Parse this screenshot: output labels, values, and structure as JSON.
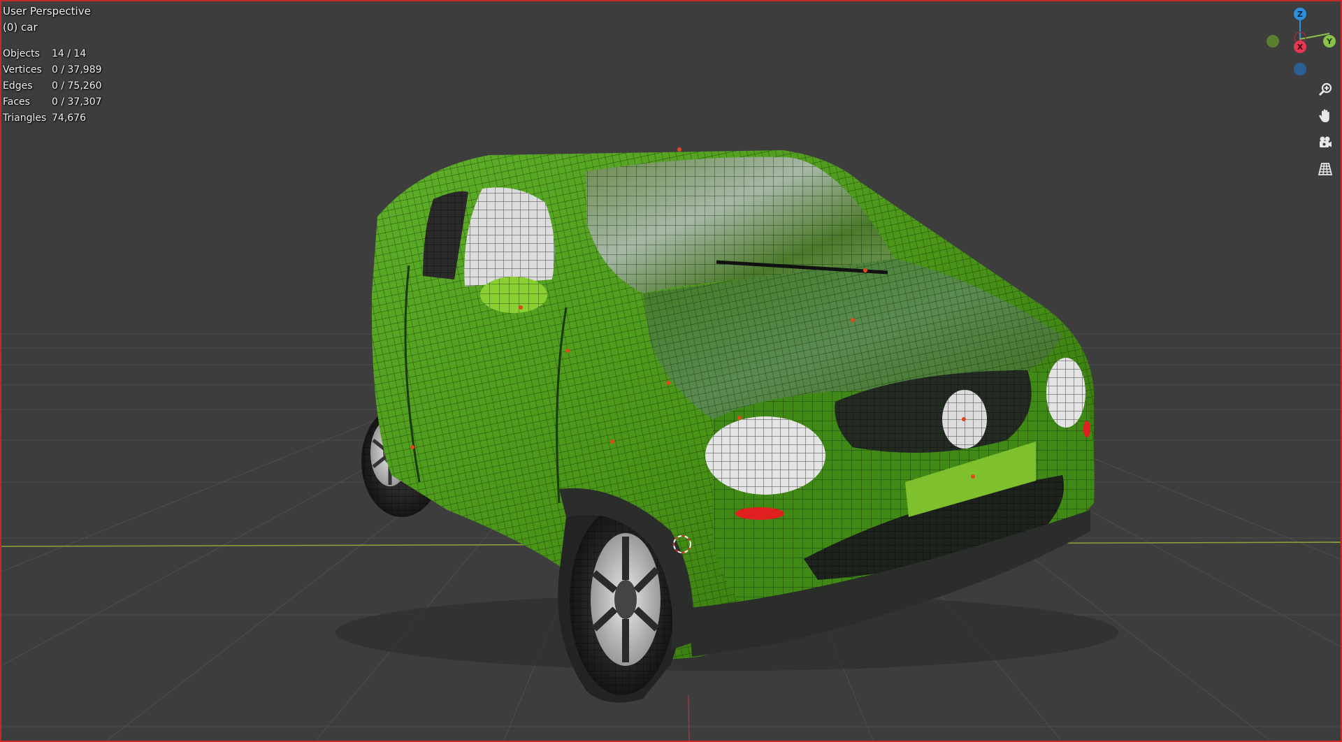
{
  "viewport": {
    "view_name": "User Perspective",
    "object_name": "(0) car"
  },
  "stats": [
    {
      "label": "Objects",
      "value": "14 / 14"
    },
    {
      "label": "Vertices",
      "value": "0 / 37,989"
    },
    {
      "label": "Edges",
      "value": "0 / 75,260"
    },
    {
      "label": "Faces",
      "value": "0 / 37,307"
    },
    {
      "label": "Triangles",
      "value": "74,676"
    }
  ],
  "gizmo": {
    "axes": {
      "x": "X",
      "y": "Y",
      "z": "Z"
    },
    "colors": {
      "x": "#e8384f",
      "y": "#8bc34a",
      "z": "#2d8fe0",
      "neg_x": "#9b2d3a",
      "neg_y": "#5a7f2e",
      "neg_z": "#2a5f94"
    }
  },
  "navigation": {
    "icons": [
      "zoom-icon",
      "pan-hand-icon",
      "camera-icon",
      "perspective-grid-icon"
    ]
  },
  "colors": {
    "background": "#3d3d3d",
    "grid": "#555555",
    "x_axis_line": "#8fa33a",
    "y_axis_line": "#a0353a",
    "active_frame": "#c42a2a",
    "car_body": "#4f9a1e",
    "wire": "#0e2a04"
  }
}
